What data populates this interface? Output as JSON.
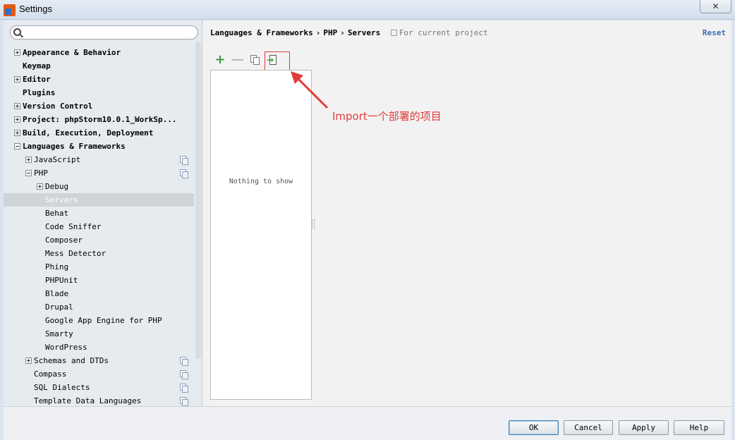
{
  "window": {
    "title": "Settings",
    "close_label": "✕"
  },
  "search": {
    "placeholder": "",
    "value": ""
  },
  "tree": [
    {
      "label": "Appearance & Behavior",
      "level": 0,
      "expander": "plus",
      "bold": true,
      "project": false,
      "selected": false
    },
    {
      "label": "Keymap",
      "level": 0,
      "expander": "none",
      "bold": true,
      "project": false,
      "selected": false
    },
    {
      "label": "Editor",
      "level": 0,
      "expander": "plus",
      "bold": true,
      "project": false,
      "selected": false
    },
    {
      "label": "Plugins",
      "level": 0,
      "expander": "none",
      "bold": true,
      "project": false,
      "selected": false
    },
    {
      "label": "Version Control",
      "level": 0,
      "expander": "plus",
      "bold": true,
      "project": false,
      "selected": false
    },
    {
      "label": "Project: phpStorm10.0.1_WorkSp...",
      "level": 0,
      "expander": "plus",
      "bold": true,
      "project": false,
      "selected": false
    },
    {
      "label": "Build, Execution, Deployment",
      "level": 0,
      "expander": "plus",
      "bold": true,
      "project": false,
      "selected": false
    },
    {
      "label": "Languages & Frameworks",
      "level": 0,
      "expander": "minus",
      "bold": true,
      "project": false,
      "selected": false
    },
    {
      "label": "JavaScript",
      "level": 1,
      "expander": "plus",
      "bold": false,
      "project": true,
      "selected": false
    },
    {
      "label": "PHP",
      "level": 1,
      "expander": "minus",
      "bold": false,
      "project": true,
      "selected": false
    },
    {
      "label": "Debug",
      "level": 2,
      "expander": "plus",
      "bold": false,
      "project": false,
      "selected": false
    },
    {
      "label": "Servers",
      "level": 2,
      "expander": "none",
      "bold": false,
      "project": false,
      "selected": true
    },
    {
      "label": "Behat",
      "level": 2,
      "expander": "none",
      "bold": false,
      "project": false,
      "selected": false
    },
    {
      "label": "Code Sniffer",
      "level": 2,
      "expander": "none",
      "bold": false,
      "project": false,
      "selected": false
    },
    {
      "label": "Composer",
      "level": 2,
      "expander": "none",
      "bold": false,
      "project": false,
      "selected": false
    },
    {
      "label": "Mess Detector",
      "level": 2,
      "expander": "none",
      "bold": false,
      "project": false,
      "selected": false
    },
    {
      "label": "Phing",
      "level": 2,
      "expander": "none",
      "bold": false,
      "project": false,
      "selected": false
    },
    {
      "label": "PHPUnit",
      "level": 2,
      "expander": "none",
      "bold": false,
      "project": false,
      "selected": false
    },
    {
      "label": "Blade",
      "level": 2,
      "expander": "none",
      "bold": false,
      "project": false,
      "selected": false
    },
    {
      "label": "Drupal",
      "level": 2,
      "expander": "none",
      "bold": false,
      "project": false,
      "selected": false
    },
    {
      "label": "Google App Engine for PHP",
      "level": 2,
      "expander": "none",
      "bold": false,
      "project": false,
      "selected": false
    },
    {
      "label": "Smarty",
      "level": 2,
      "expander": "none",
      "bold": false,
      "project": false,
      "selected": false
    },
    {
      "label": "WordPress",
      "level": 2,
      "expander": "none",
      "bold": false,
      "project": false,
      "selected": false
    },
    {
      "label": "Schemas and DTDs",
      "level": 1,
      "expander": "plus",
      "bold": false,
      "project": true,
      "selected": false
    },
    {
      "label": "Compass",
      "level": 1,
      "expander": "none",
      "bold": false,
      "project": true,
      "selected": false
    },
    {
      "label": "SQL Dialects",
      "level": 1,
      "expander": "none",
      "bold": false,
      "project": true,
      "selected": false
    },
    {
      "label": "Template Data Languages",
      "level": 1,
      "expander": "none",
      "bold": false,
      "project": true,
      "selected": false
    }
  ],
  "breadcrumb": {
    "items": [
      "Languages & Frameworks",
      "PHP",
      "Servers"
    ],
    "separator": "›",
    "scope_note": "For current project"
  },
  "reset_label": "Reset",
  "toolbar": {
    "add": "+",
    "remove": "—",
    "copy_icon": "copy-icon",
    "import_icon": "import-icon"
  },
  "list": {
    "empty_text": "Nothing to show"
  },
  "annotation": {
    "text": "Import一个部署的项目",
    "color": "#e03b3b"
  },
  "buttons": {
    "ok": "OK",
    "cancel": "Cancel",
    "apply": "Apply",
    "help": "Help"
  },
  "colors": {
    "selected_row": "#cfd4d9",
    "link": "#3b6fb6",
    "add_green": "#3a9a3a"
  }
}
